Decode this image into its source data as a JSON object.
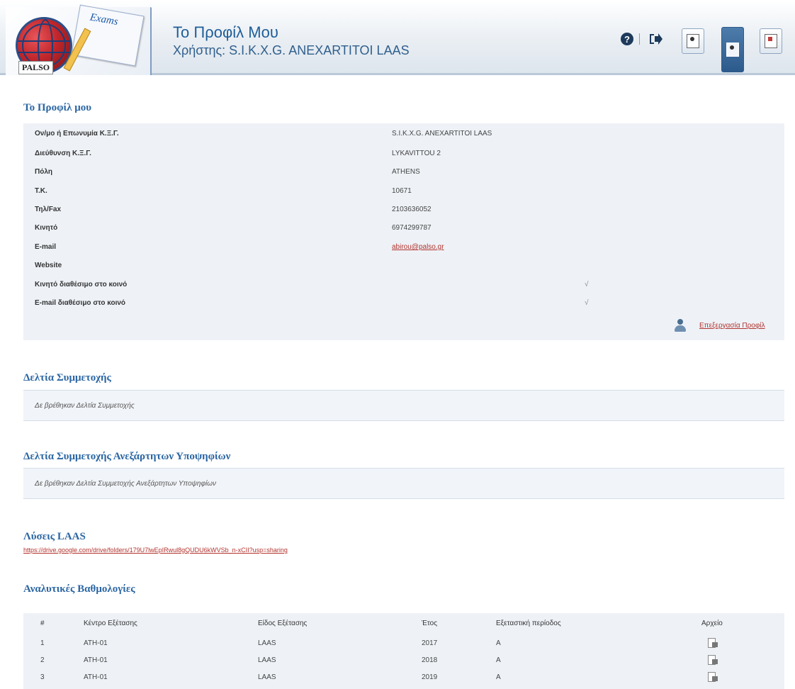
{
  "header": {
    "logo_badge": "PALSO",
    "logo_card": "Exams",
    "title": "Το Προφίλ Μου",
    "user_line": "Χρήστης: S.I.K.X.G. ANEXARTITOI LAAS"
  },
  "profile": {
    "section_title": "Το Προφίλ μου",
    "rows": [
      {
        "label": "Ον/μο ή Επωνυμία Κ.Ξ.Γ.",
        "value": "S.I.K.X.G. ANEXARTITOI LAAS"
      },
      {
        "label": "Διεύθυνση Κ.Ξ.Γ.",
        "value": "LYKAVITTOU 2"
      },
      {
        "label": "Πόλη",
        "value": "ATHENS"
      },
      {
        "label": "Τ.Κ.",
        "value": "10671"
      },
      {
        "label": "Τηλ/Fax",
        "value": "2103636052"
      },
      {
        "label": "Κινητό",
        "value": "6974299787"
      },
      {
        "label": "E-mail",
        "value": "abirou@palso.gr"
      },
      {
        "label": "Website",
        "value": ""
      },
      {
        "label": "Κινητό διαθέσιμο στο κοινό",
        "value": "√"
      },
      {
        "label": "E-mail διαθέσιμο στο κοινό",
        "value": "√"
      }
    ],
    "edit_label": "Επεξεργασία Προφίλ"
  },
  "participation": {
    "section_title": "Δελτία Συμμετοχής",
    "empty_text": "Δε βρέθηκαν Δελτία Συμμετοχής"
  },
  "independent": {
    "section_title": "Δελτία Συμμετοχής Ανεξάρτητων Υποψηφίων",
    "empty_text": "Δε βρέθηκαν Δελτία Συμμετοχής Ανεξάρτητων Υποψηφίων"
  },
  "laas": {
    "section_title": "Λύσεις LAAS",
    "link": "https://drive.google.com/drive/folders/179U7lwEpIRwul8gQUDU6kWVSb_n-xCII?usp=sharing"
  },
  "grades": {
    "section_title": "Αναλυτικές Βαθμολογίες",
    "columns": [
      "#",
      "Κέντρο Εξέτασης",
      "Είδος Εξέτασης",
      "Έτος",
      "Εξεταστική περίοδος",
      "Αρχείο"
    ],
    "rows": [
      {
        "n": "1",
        "center": "ATH-01",
        "type": "LAAS",
        "year": "2017",
        "period": "A"
      },
      {
        "n": "2",
        "center": "ATH-01",
        "type": "LAAS",
        "year": "2018",
        "period": "A"
      },
      {
        "n": "3",
        "center": "ATH-01",
        "type": "LAAS",
        "year": "2019",
        "period": "A"
      }
    ]
  },
  "icons": [
    "help-icon",
    "logout-icon",
    "profile-card-icon",
    "user-icon",
    "certificate-icon",
    "edit-profile-icon",
    "file-icon"
  ]
}
